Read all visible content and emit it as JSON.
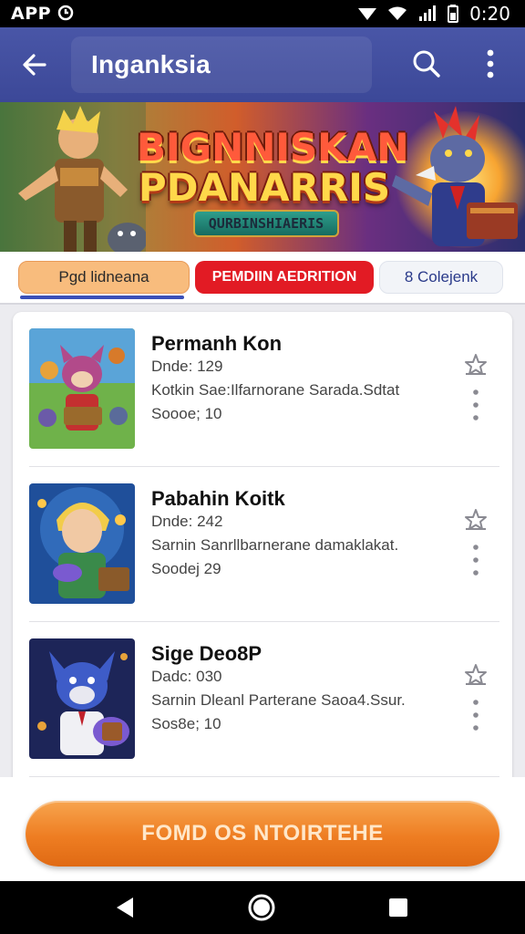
{
  "status_bar": {
    "left_text": "APP",
    "time": "0:20"
  },
  "toolbar": {
    "title": "Inganksia"
  },
  "banner": {
    "logo_line1": "BIGNNISKAN",
    "logo_line2": "PDANARRIS",
    "plaque_text": "QURBINSHIAERIS"
  },
  "tabs": [
    {
      "label": "Pgd lidneana",
      "selected": true
    },
    {
      "label": "PEMDIIN AEDRITION",
      "selected": false
    },
    {
      "label": "8 Colejenk",
      "selected": false
    }
  ],
  "items": [
    {
      "name": "Permanh Kon",
      "line1": "Dnde: 129",
      "line2": "Kotkin Sae:Ilfarnorane Sarada.Sdtat",
      "line3": "Soooe; 10"
    },
    {
      "name": "Pabahin Koitk",
      "line1": "Dnde: 242",
      "line2": "Sarnin Sanrllbarnerane damaklakat.",
      "line3": "Soodej 29"
    },
    {
      "name": "Sige Deo8P",
      "line1": "Dadc: 030",
      "line2": "Sarnin Dleanl Parterane Saoa4.Ssur.",
      "line3": "Sos8e; 10"
    }
  ],
  "cta": {
    "label": "FOMD OS NTOIRTEHE"
  },
  "colors": {
    "toolbar": "#4956a7",
    "tab_selected": "#f8bc7d",
    "tab_red": "#e21b24",
    "cta": "#ee7d22"
  }
}
